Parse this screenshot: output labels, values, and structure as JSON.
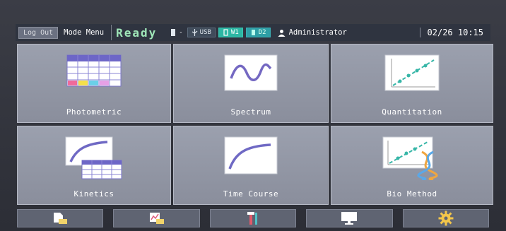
{
  "topbar": {
    "logout_label": "Log Out",
    "mode_menu_label": "Mode Menu",
    "status": "Ready",
    "lamp_indicator": "-",
    "usb_label": "USB",
    "w1_label": "W1",
    "o2_label": "D2",
    "user": "Administrator",
    "datetime": "02/26  10:15"
  },
  "tiles": [
    {
      "label": "Photometric"
    },
    {
      "label": "Spectrum"
    },
    {
      "label": "Quantitation"
    },
    {
      "label": "Kinetics"
    },
    {
      "label": "Time Course"
    },
    {
      "label": "Bio Method"
    }
  ],
  "bottom_bar": [
    {
      "icon": "file-icon"
    },
    {
      "icon": "data-file-icon"
    },
    {
      "icon": "tools-icon"
    },
    {
      "icon": "monitor-icon"
    },
    {
      "icon": "gear-icon"
    }
  ],
  "colors": {
    "ready": "#9fe6b8",
    "accent_teal": "#2db7a4",
    "tile_bg": "#9ba0ae"
  }
}
